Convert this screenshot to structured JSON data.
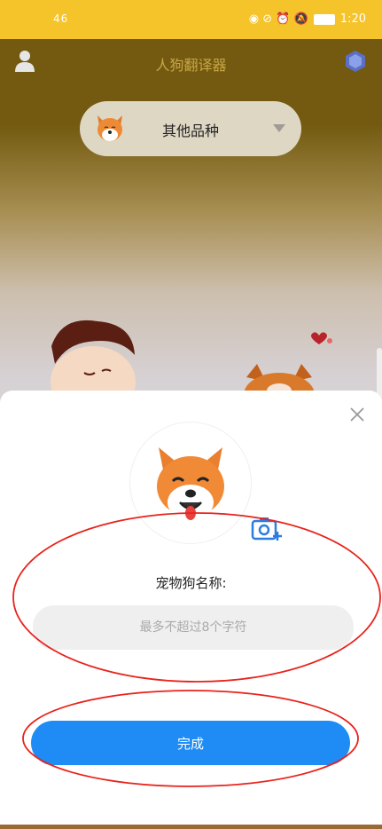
{
  "status_bar": {
    "signal": "46",
    "time": "1:20"
  },
  "header": {
    "title": "人狗翻译器",
    "left_icon": "user-icon",
    "right_icon": "vip-badge-icon"
  },
  "breed_selector": {
    "selected": "其他品种",
    "icon": "shiba-avatar-icon"
  },
  "dialog": {
    "close_icon": "close-icon",
    "avatar_icon": "shiba-avatar-icon",
    "camera_icon": "camera-add-icon",
    "name_label": "宠物狗名称:",
    "name_input": {
      "value": "",
      "placeholder": "最多不超过8个字符"
    },
    "done_label": "完成"
  },
  "colors": {
    "statusbar": "#f5c32a",
    "primary": "#1f8cf5",
    "annotation": "#e8231c"
  }
}
